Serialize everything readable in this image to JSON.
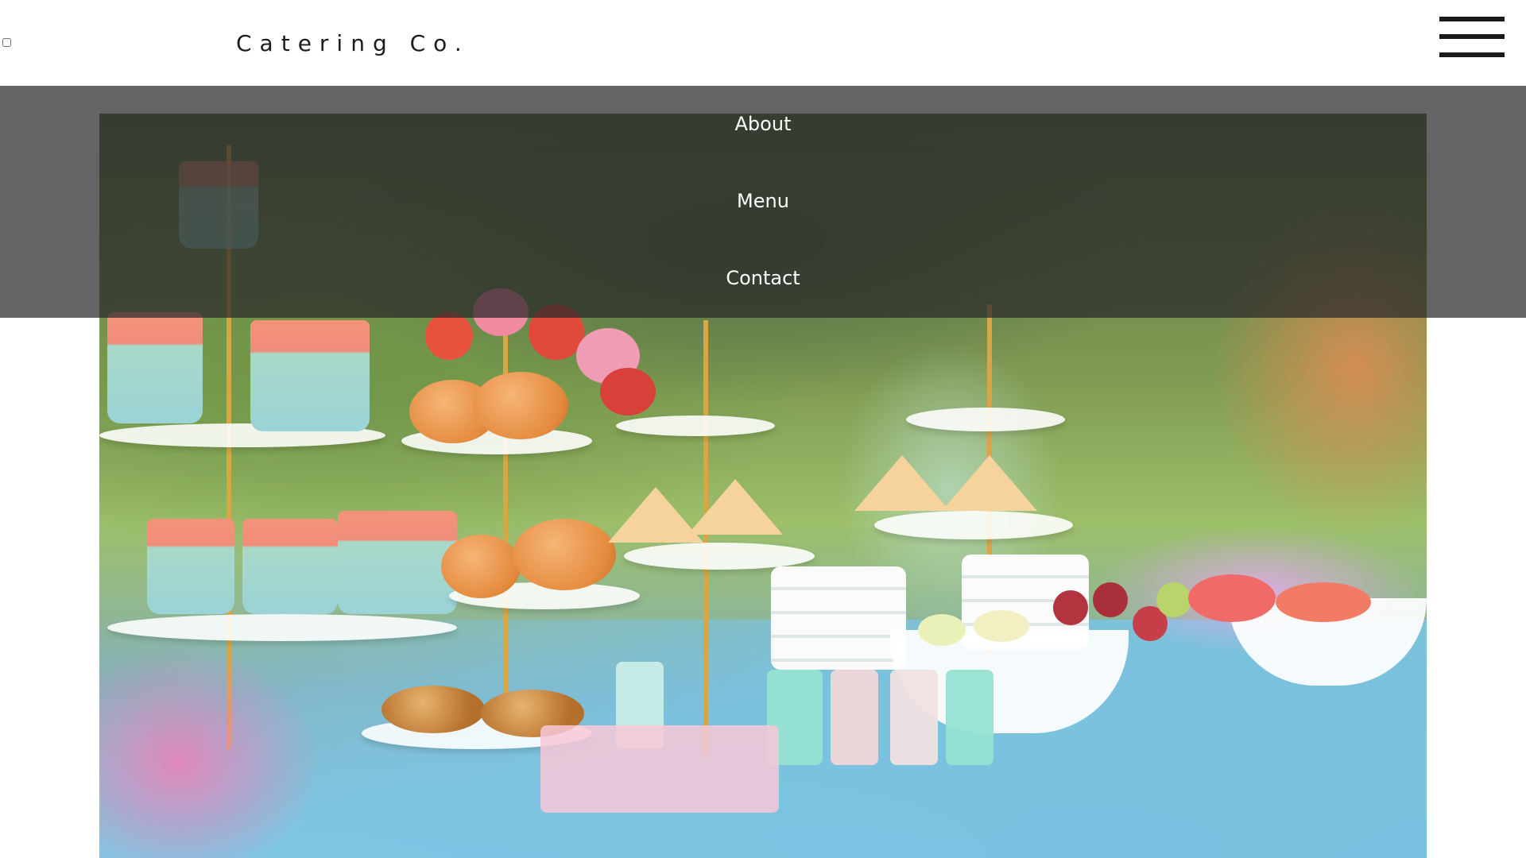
{
  "header": {
    "brand": "Catering Co.",
    "menu_toggle_icon": "hamburger-menu-icon"
  },
  "nav": {
    "items": [
      {
        "label": "About"
      },
      {
        "label": "Menu"
      },
      {
        "label": "Contact"
      }
    ]
  },
  "hero": {
    "image_subject": "outdoor catering dessert table with cupcakes, cream puffs, flowers, fruit and drinks"
  },
  "colors": {
    "header_bg": "#ffffff",
    "overlay_bg": "#282828",
    "nav_text": "#ffffff",
    "brand_text": "#1c1c1c"
  }
}
